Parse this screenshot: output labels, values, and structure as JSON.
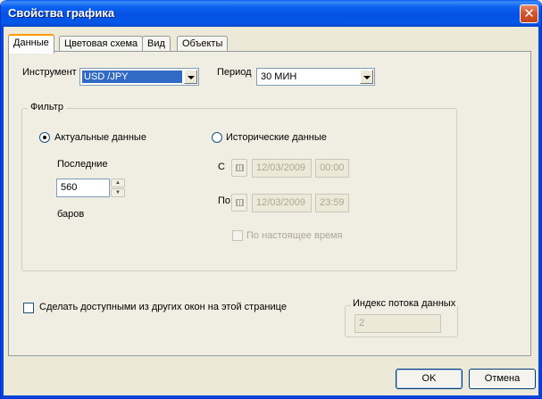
{
  "window": {
    "title": "Свойства графика",
    "close_glyph": "✕"
  },
  "tabs": [
    {
      "label": "Данные",
      "active": true
    },
    {
      "label": "Цветовая схема",
      "active": false
    },
    {
      "label": "Вид",
      "active": false
    },
    {
      "label": "Объекты",
      "active": false
    }
  ],
  "instrument": {
    "label": "Инструмент",
    "value": "USD /JPY"
  },
  "period": {
    "label": "Период",
    "value": "30 МИН"
  },
  "filter": {
    "legend": "Фильтр",
    "actual": {
      "label": "Актуальные данные",
      "selected": true,
      "last_label": "Последние",
      "bars_value": "560",
      "bars_label": "баров"
    },
    "historical": {
      "label": "Исторические данные",
      "selected": false,
      "from_label": "С",
      "from_date": "12/03/2009",
      "from_time": "00:00",
      "to_label": "По",
      "to_date": "12/03/2009",
      "to_time": "23:59",
      "to_now_label": "По настоящее время"
    }
  },
  "share": {
    "label": "Сделать доступными из других окон на этой странице",
    "checked": false
  },
  "data_stream": {
    "label": "Индекс потока данных",
    "value": "2"
  },
  "buttons": {
    "ok": "OK",
    "cancel": "Отмена"
  },
  "icons": {
    "calendar": "calendar-icon",
    "spin_up": "▲",
    "spin_down": "▼"
  },
  "colors": {
    "titlebar": "#0a5ef0",
    "selection": "#316ac5",
    "tab_highlight": "#ff9a00"
  }
}
